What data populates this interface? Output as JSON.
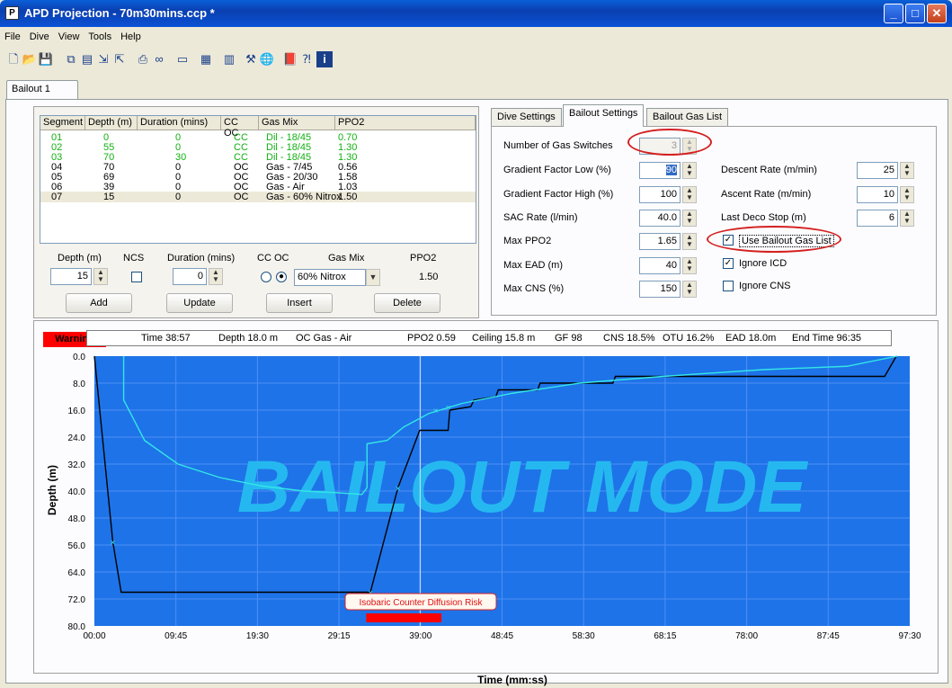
{
  "window": {
    "title": "APD Projection - 70m30mins.ccp *",
    "app_icon": "P"
  },
  "menu": [
    "File",
    "Dive",
    "View",
    "Tools",
    "Help"
  ],
  "doc_tab": "Bailout 1",
  "segments": {
    "headers": [
      "Segment",
      "Depth (m)",
      "Duration (mins)",
      "CC OC",
      "Gas Mix",
      "PPO2"
    ],
    "rows": [
      [
        "01",
        "0",
        "0",
        "CC",
        "Dil - 18/45",
        "0.70"
      ],
      [
        "02",
        "55",
        "0",
        "CC",
        "Dil - 18/45",
        "1.30"
      ],
      [
        "03",
        "70",
        "30",
        "CC",
        "Dil - 18/45",
        "1.30"
      ],
      [
        "04",
        "70",
        "0",
        "OC",
        "Gas - 7/45",
        "0.56"
      ],
      [
        "05",
        "69",
        "0",
        "OC",
        "Gas - 20/30",
        "1.58"
      ],
      [
        "06",
        "39",
        "0",
        "OC",
        "Gas - Air",
        "1.03"
      ],
      [
        "07",
        "15",
        "0",
        "OC",
        "Gas - 60% Nitrox",
        "1.50"
      ]
    ],
    "active_color": "#12b012"
  },
  "editor": {
    "depth_label": "Depth (m)",
    "ncs_label": "NCS",
    "duration_label": "Duration (mins)",
    "ccoc_label": "CC OC",
    "gasmix_label": "Gas Mix",
    "ppo2_label": "PPO2",
    "depth": "15",
    "duration": "0",
    "gasmix": "60% Nitrox",
    "ppo2": "1.50",
    "add": "Add",
    "update": "Update",
    "insert": "Insert",
    "delete": "Delete"
  },
  "settings_tabs": [
    "Dive Settings",
    "Bailout Settings",
    "Bailout Gas List"
  ],
  "settings": {
    "num_switches_label": "Number of Gas Switches",
    "num_switches": "3",
    "gf_low_label": "Gradient Factor Low (%)",
    "gf_low": "90",
    "gf_high_label": "Gradient Factor High (%)",
    "gf_high": "100",
    "sac_label": "SAC Rate (l/min)",
    "sac": "40.0",
    "max_ppo2_label": "Max PPO2",
    "max_ppo2": "1.65",
    "max_ead_label": "Max EAD (m)",
    "max_ead": "40",
    "max_cns_label": "Max CNS (%)",
    "max_cns": "150",
    "descent_label": "Descent Rate (m/min)",
    "descent": "25",
    "ascent_label": "Ascent Rate (m/min)",
    "ascent": "10",
    "last_deco_label": "Last Deco Stop (m)",
    "last_deco": "6",
    "use_bailout_label": "Use Bailout Gas List",
    "ignore_icd_label": "Ignore ICD",
    "ignore_cns_label": "Ignore CNS"
  },
  "status": {
    "warning": "Warning",
    "time": "Time 38:57",
    "depth": "Depth 18.0 m",
    "gas": "OC  Gas - Air",
    "ppo2": "PPO2 0.59",
    "ceiling": "Ceiling 15.8 m",
    "gf": "GF 98",
    "cns": "CNS 18.5%",
    "otu": "OTU 16.2%",
    "ead": "EAD 18.0m",
    "end": "End Time 96:35"
  },
  "chart_data": {
    "type": "line",
    "watermark": "BAILOUT MODE",
    "xlabel": "Time (mm:ss)",
    "ylabel": "Depth (m)",
    "x_ticks": [
      "00:00",
      "09:45",
      "19:30",
      "29:15",
      "39:00",
      "48:45",
      "58:30",
      "68:15",
      "78:00",
      "87:45",
      "97:30"
    ],
    "y_ticks": [
      "0.0",
      "8.0",
      "16.0",
      "24.0",
      "32.0",
      "40.0",
      "48.0",
      "56.0",
      "64.0",
      "72.0",
      "80.0"
    ],
    "xlim_minutes": [
      0,
      97.5
    ],
    "ylim": [
      0,
      80
    ],
    "annotation": "Isobaric Counter Diffusion Risk",
    "icd_risk_minutes": [
      32.5,
      41.5
    ],
    "cursor_minutes": 38.95,
    "colors": {
      "background": "#1e73e8",
      "profile": "#000000",
      "ceiling": "#33e6e6",
      "grid": "#4f8ff5",
      "watermark": "#25b8f0"
    },
    "series": [
      {
        "name": "profile",
        "points": [
          [
            0,
            0
          ],
          [
            2.2,
            55
          ],
          [
            3.2,
            70
          ],
          [
            33,
            70
          ],
          [
            36.3,
            39
          ],
          [
            38.9,
            22
          ],
          [
            42.3,
            22
          ],
          [
            42.5,
            16
          ],
          [
            45,
            15
          ],
          [
            45.4,
            13
          ],
          [
            48,
            12
          ],
          [
            48.3,
            10
          ],
          [
            53,
            10
          ],
          [
            53.3,
            8
          ],
          [
            62,
            8
          ],
          [
            62.3,
            6
          ],
          [
            94.5,
            6
          ],
          [
            95.9,
            0
          ]
        ]
      },
      {
        "name": "ceiling",
        "points": [
          [
            3.5,
            0
          ],
          [
            3.5,
            13
          ],
          [
            6,
            25
          ],
          [
            10,
            32
          ],
          [
            15,
            36
          ],
          [
            20,
            38.5
          ],
          [
            25,
            40
          ],
          [
            29,
            40.5
          ],
          [
            32,
            41
          ],
          [
            32.6,
            39
          ],
          [
            32.6,
            26
          ],
          [
            35,
            25
          ],
          [
            37,
            21
          ],
          [
            40,
            17
          ],
          [
            44,
            14
          ],
          [
            50,
            11
          ],
          [
            58,
            8
          ],
          [
            68,
            6
          ],
          [
            80,
            4
          ],
          [
            90,
            3
          ],
          [
            96,
            0
          ]
        ]
      }
    ],
    "markers": [
      [
        2.2,
        55
      ],
      [
        33,
        70
      ],
      [
        36.3,
        39
      ],
      [
        42.3,
        15
      ],
      [
        40.8,
        16
      ]
    ]
  }
}
